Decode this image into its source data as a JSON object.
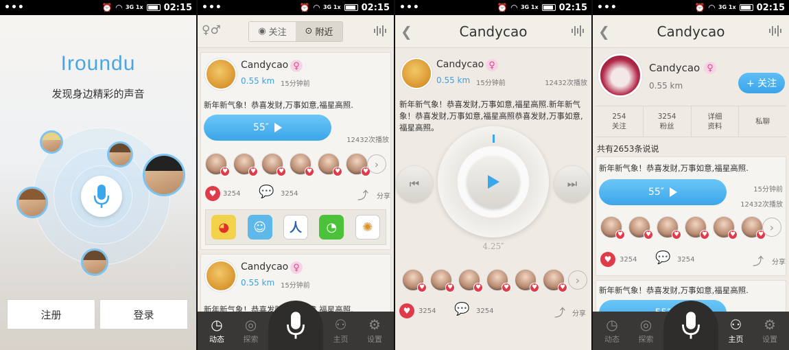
{
  "status": {
    "time": "02:15",
    "network": "3G 1x"
  },
  "welcome": {
    "app_name": "Iroundu",
    "slogan": "发现身边精彩的声音",
    "register_label": "注册",
    "login_label": "登录"
  },
  "feed": {
    "tabs": [
      {
        "label": "关注"
      },
      {
        "label": "附近"
      }
    ],
    "posts": [
      {
        "user": "Candycao",
        "distance": "0.55 km",
        "time": "15分钟前",
        "text": "新年新气象！恭喜发财,万事如意,福星高照.",
        "duration": "55″",
        "plays": "12432次播放",
        "likes": "3254",
        "comments": "3254",
        "share": "分享"
      },
      {
        "user": "Candycao",
        "distance": "0.55 km",
        "time": "15分钟前",
        "text": "新年新气象！恭喜发财,万事如意,福星高照."
      }
    ]
  },
  "player": {
    "title": "Candycao",
    "user": "Candycao",
    "distance": "0.55 km",
    "time": "15分钟前",
    "plays": "12432次播放",
    "text": "新年新气象！恭喜发财,万事如意,福星高照.新年新气象！恭喜发财,万事如意,福星高照恭喜发财,万事如意,福星高照。",
    "elapsed": "4.25″",
    "likes": "3254",
    "comments": "3254",
    "share": "分享"
  },
  "profile": {
    "title": "Candycao",
    "user": "Candycao",
    "distance": "0.55 km",
    "follow_label": "+ 关注",
    "stats": [
      {
        "value": "254",
        "label": "关注"
      },
      {
        "value": "3254",
        "label": "粉丝"
      },
      {
        "value": "详细",
        "label": "资料"
      },
      {
        "value": "",
        "label": "私聊"
      }
    ],
    "post_count": "共有2653条说说",
    "posts": [
      {
        "text": "新年新气象！恭喜发财,万事如意,福星高照.",
        "duration": "55″",
        "time": "15分钟前",
        "plays": "12432次播放",
        "likes": "3254",
        "comments": "3254",
        "share": "分享"
      },
      {
        "text": "新年新气象！恭喜发财,万事如意,福星高照.",
        "duration": "55″"
      }
    ]
  },
  "tabbar": {
    "items": [
      {
        "label": "动态",
        "icon": "clock-icon"
      },
      {
        "label": "探索",
        "icon": "globe-icon"
      },
      {
        "label": "主页",
        "icon": "person-icon"
      },
      {
        "label": "设置",
        "icon": "gear-icon"
      }
    ]
  },
  "colors": {
    "accent": "#3ba6ea",
    "like": "#e03b4a",
    "female": "#e0468c",
    "tabbar": "#3a3836"
  }
}
